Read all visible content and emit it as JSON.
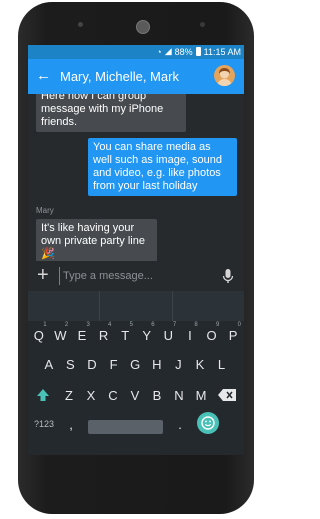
{
  "status_bar": {
    "battery": "88%",
    "time": "11:15 AM"
  },
  "app_bar": {
    "title": "Mary, Michelle, Mark"
  },
  "messages": [
    {
      "from": "me",
      "sender": "",
      "text": "Here how I can group message with my iPhone friends."
    },
    {
      "from": "me_out",
      "sender": "",
      "text": "You can share media as well such as image, sound and video, e.g. like photos from your last holiday"
    },
    {
      "from": "other",
      "sender": "Mary",
      "text": "It's like having your own private party line 🎉"
    }
  ],
  "compose": {
    "placeholder": "Type a message..."
  },
  "keyboard": {
    "row1": [
      "Q",
      "W",
      "E",
      "R",
      "T",
      "Y",
      "U",
      "I",
      "O",
      "P"
    ],
    "row1_hints": [
      "1",
      "2",
      "3",
      "4",
      "5",
      "6",
      "7",
      "8",
      "9",
      "0"
    ],
    "row2": [
      "A",
      "S",
      "D",
      "F",
      "G",
      "H",
      "J",
      "K",
      "L"
    ],
    "row3": [
      "Z",
      "X",
      "C",
      "V",
      "B",
      "N",
      "M"
    ],
    "symbols_label": "?123",
    "comma": ",",
    "period": "."
  },
  "colors": {
    "accent": "#2196f3",
    "status": "#1b83c6",
    "emoji_key": "#4ac1b7"
  }
}
